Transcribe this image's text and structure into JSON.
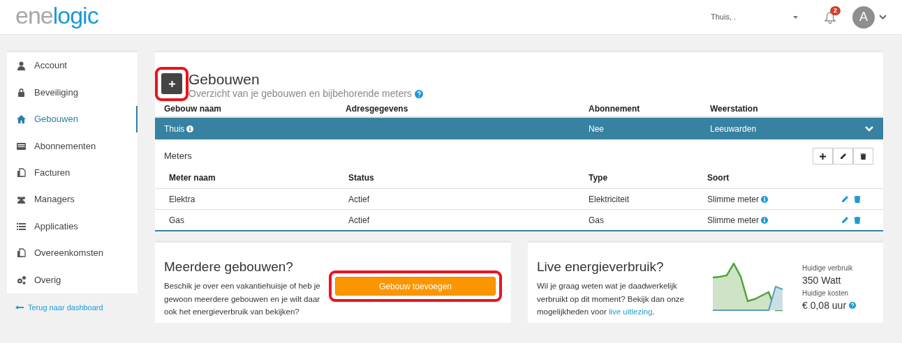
{
  "header": {
    "logo_left": "ene",
    "logo_right": "logic",
    "location": "Thuis, .",
    "notifications": "2",
    "avatar": "A"
  },
  "sidebar": {
    "items": [
      {
        "label": "Account",
        "selected": false
      },
      {
        "label": "Beveiliging",
        "selected": false
      },
      {
        "label": "Gebouwen",
        "selected": true
      },
      {
        "label": "Abonnementen",
        "selected": false
      },
      {
        "label": "Facturen",
        "selected": false
      },
      {
        "label": "Managers",
        "selected": false
      },
      {
        "label": "Applicaties",
        "selected": false
      },
      {
        "label": "Overeenkomsten",
        "selected": false
      },
      {
        "label": "Overig",
        "selected": false
      }
    ],
    "back_link": "Terug naar dashboard"
  },
  "buildings": {
    "add_button": {
      "highlighted": true
    },
    "title": "Gebouwen",
    "subtitle": "Overzicht van je gebouwen en bijbehorende meters",
    "columns": [
      "Gebouw naam",
      "Adresgegevens",
      "Abonnement",
      "Weerstation"
    ],
    "rows": [
      {
        "name": "Thuis",
        "address": "",
        "subscription": "Nee",
        "weather_station": "Leeuwarden",
        "expanded": true
      }
    ],
    "meters": {
      "title": "Meters",
      "columns": [
        "Meter naam",
        "Status",
        "Type",
        "Soort"
      ],
      "rows": [
        {
          "name": "Elektra",
          "status": "Actief",
          "type": "Elektriciteit",
          "kind": "Slimme meter"
        },
        {
          "name": "Gas",
          "status": "Actief",
          "type": "Gas",
          "kind": "Slimme meter"
        }
      ]
    }
  },
  "promo_buildings": {
    "title": "Meerdere gebouwen?",
    "text": "Beschik je over een vakantiehuisje of heb je gewoon meerdere gebouwen en je wilt daar ook het energieverbruik van bekijken?",
    "button": {
      "label": "Gebouw toevoegen",
      "highlighted": true
    }
  },
  "promo_live": {
    "title": "Live energieverbruik?",
    "text": "Wil je graag weten wat je daadwerkelijk verbruikt op dit moment? Bekijk dan onze mogelijkheden voor ",
    "link": "live uitlezing",
    "text_end": ".",
    "usage_label": "Huidige verbruik",
    "usage": "350 Watt",
    "cost_label": "Huidige kosten",
    "cost": "€ 0,08 uur"
  }
}
